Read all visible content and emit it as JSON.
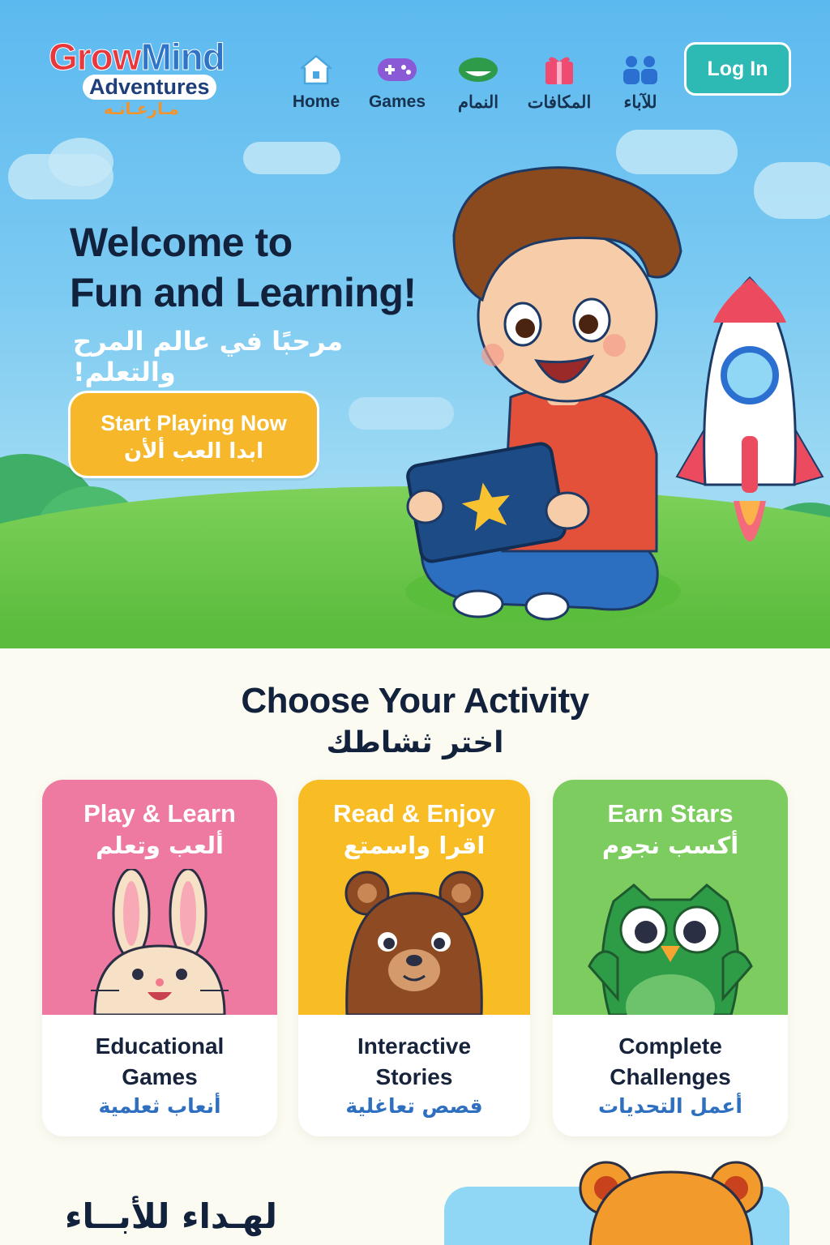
{
  "brand": {
    "line1": [
      "Grow",
      "Mind"
    ],
    "line2": "Adventures",
    "line3": "مـارعـانـه"
  },
  "nav": {
    "items": [
      {
        "label": "Home",
        "icon": "home-icon"
      },
      {
        "label": "Games",
        "icon": "gamepad-icon"
      },
      {
        "label": "النمام",
        "icon": "sleep-icon"
      },
      {
        "label": "المكافات",
        "icon": "gift-icon"
      },
      {
        "label": "للآباء",
        "icon": "parents-icon"
      }
    ],
    "login_label": "Log In"
  },
  "hero": {
    "title_line1": "Welcome to",
    "title_line2": "Fun and Learning!",
    "subtitle_ar": "مرحبًا في عالم المرح والتعلم!",
    "cta_en": "Start Playing Now",
    "cta_ar": "ابدا العب ألأن"
  },
  "activities": {
    "title": "Choose Your Activity",
    "title_ar": "اختر ثشاطك",
    "cards": [
      {
        "head": "Play & Learn",
        "head_ar": "ألعب وتعلم",
        "body_line1": "Educational",
        "body_line2": "Games",
        "body_ar": "أنعاب ثعلمية",
        "color": "#ef7aa1",
        "mascot": "bunny-illustration"
      },
      {
        "head": "Read & Enjoy",
        "head_ar": "اقرا واسمتع",
        "body_line1": "Interactive",
        "body_line2": "Stories",
        "body_ar": "قصص تعاغلية",
        "color": "#f8bd24",
        "mascot": "bear-illustration"
      },
      {
        "head": "Earn Stars",
        "head_ar": "أكسب نجوم",
        "body_line1": "Complete",
        "body_line2": "Challenges",
        "body_ar": "أعمل التحديات",
        "color": "#7ccc5f",
        "mascot": "owl-illustration"
      }
    ]
  },
  "parents": {
    "title_ar": "لهـداء للأبــاء"
  }
}
